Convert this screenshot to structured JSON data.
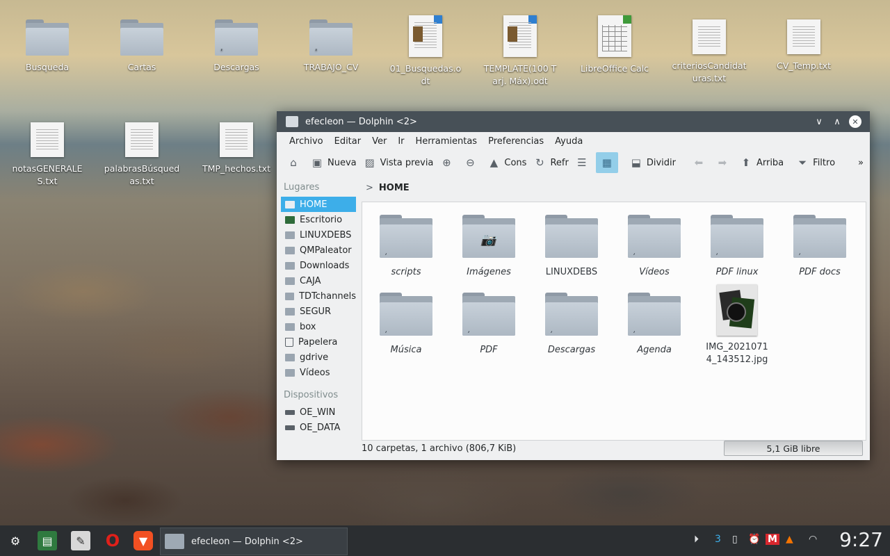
{
  "desktop": {
    "icons_row1": [
      {
        "label": "Busqueda",
        "type": "folder"
      },
      {
        "label": "Cartas",
        "type": "folder"
      },
      {
        "label": "Descargas",
        "type": "folder"
      },
      {
        "label": "TRABAJO_CV",
        "type": "folder"
      },
      {
        "label": "01_Busquedas.odt",
        "type": "odt"
      },
      {
        "label": "TEMPLATE(100 Tarj. Máx).odt",
        "type": "odt"
      },
      {
        "label": "LibreOffice Calc",
        "type": "calc"
      },
      {
        "label": "criteriosCandidaturas.txt",
        "type": "txt"
      },
      {
        "label": "CV_Temp.txt",
        "type": "txt"
      }
    ],
    "icons_row2": [
      {
        "label": "notasGENERALES.txt",
        "type": "txt"
      },
      {
        "label": "palabrasBúsquedas.txt",
        "type": "txt"
      },
      {
        "label": "TMP_hechos.txt",
        "type": "txt"
      }
    ]
  },
  "window": {
    "title": "efecleon — Dolphin <2>",
    "controls": {
      "minimize": "∨",
      "maximize": "∧",
      "close": "✕"
    },
    "menu": [
      "Archivo",
      "Editar",
      "Ver",
      "Ir",
      "Herramientas",
      "Preferencias",
      "Ayuda"
    ],
    "toolbar": {
      "nueva": "Nueva",
      "vista_previa": "Vista previa",
      "cons": "Cons",
      "refr": "Refr",
      "dividir": "Dividir",
      "arriba": "Arriba",
      "filtro": "Filtro"
    },
    "sidebar": {
      "places_header": "Lugares",
      "places": [
        "HOME",
        "Escritorio",
        "LINUXDEBS",
        "QMPaleator",
        "Downloads",
        "CAJA",
        "TDTchannels",
        "SEGUR",
        "box",
        "Papelera",
        "gdrive",
        "Vídeos"
      ],
      "devices_header": "Dispositivos",
      "devices": [
        "OE_WIN",
        "OE_DATA"
      ]
    },
    "breadcrumb": "HOME",
    "files": [
      {
        "label": "scripts",
        "type": "folder-link"
      },
      {
        "label": "Imágenes",
        "type": "folder-camera"
      },
      {
        "label": "LINUXDEBS",
        "type": "folder"
      },
      {
        "label": "Vídeos",
        "type": "folder-link"
      },
      {
        "label": "PDF linux",
        "type": "folder-link"
      },
      {
        "label": "PDF docs",
        "type": "folder-link"
      },
      {
        "label": "Música",
        "type": "folder-link"
      },
      {
        "label": "PDF",
        "type": "folder-link"
      },
      {
        "label": "Descargas",
        "type": "folder-link"
      },
      {
        "label": "Agenda",
        "type": "folder-link"
      },
      {
        "label": "IMG_20210714_143512.jpg",
        "type": "image"
      }
    ],
    "status": "10 carpetas, 1 archivo (806,7 KiB)",
    "free_space": "5,1 GiB libre"
  },
  "taskbar": {
    "task_title": "efecleon — Dolphin <2>",
    "clock": "9:27",
    "tray_number": "3"
  }
}
